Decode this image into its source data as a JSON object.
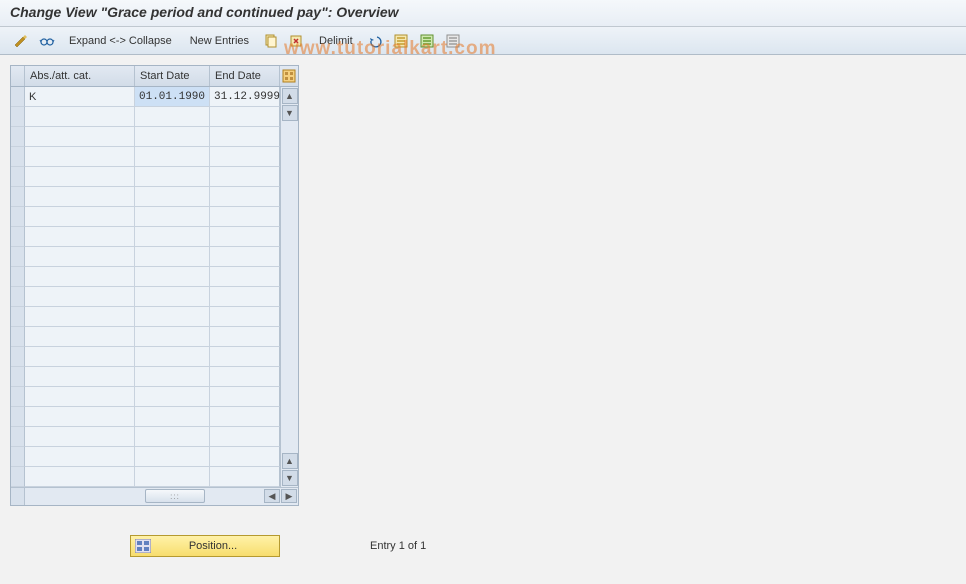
{
  "title": "Change View \"Grace period and continued pay\": Overview",
  "toolbar": {
    "expand_collapse": "Expand <-> Collapse",
    "new_entries": "New Entries",
    "delimit": "Delimit"
  },
  "grid": {
    "headers": {
      "c1": "Abs./att. cat.",
      "c2": "Start Date",
      "c3": "End Date"
    },
    "rows": [
      {
        "c1": "K",
        "c2": "01.01.1990",
        "c3": "31.12.9999",
        "c2_selected": true
      }
    ],
    "empty_rows": 19
  },
  "footer": {
    "position_label": "Position...",
    "entry_text": "Entry 1 of 1"
  },
  "watermark": "www.tutorialkart.com"
}
